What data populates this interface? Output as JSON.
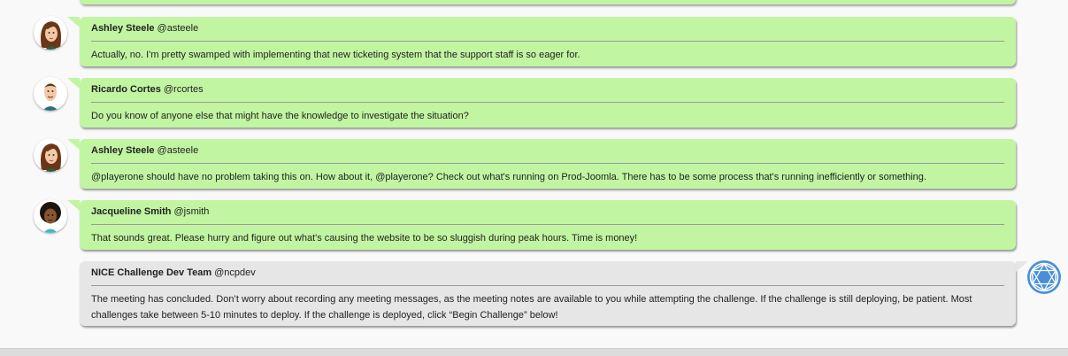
{
  "messages": [
    {
      "name": "Ashley Steele",
      "handle": "@asteele",
      "text": "Actually, no. I'm pretty swamped with implementing that new ticketing system that the support staff is so eager for.",
      "avatar": "ashley-avatar"
    },
    {
      "name": "Ricardo Cortes",
      "handle": "@rcortes",
      "text": "Do you know of anyone else that might have the knowledge to investigate the situation?",
      "avatar": "ricardo-avatar"
    },
    {
      "name": "Ashley Steele",
      "handle": "@asteele",
      "text": "@playerone should have no problem taking this on. How about it, @playerone? Check out what's running on Prod-Joomla. There has to be some process that's running inefficiently or something.",
      "avatar": "ashley-avatar"
    },
    {
      "name": "Jacqueline Smith",
      "handle": "@jsmith",
      "text": "That sounds great. Please hurry and figure out what's causing the website to be so sluggish during peak hours. Time is money!",
      "avatar": "jacqueline-avatar"
    },
    {
      "name": "NICE Challenge Dev Team",
      "handle": "@ncpdev",
      "text": "The meeting has concluded. Don’t worry about recording any meeting messages, as the meeting notes are available to you while attempting the challenge. If the challenge is still deploying, be patient. Most challenges take between 5-10 minutes to deploy. If the challenge is deployed, click “Begin Challenge” below!",
      "avatar": "nice-logo-icon"
    }
  ],
  "colors": {
    "user_bubble": "#c2f5a2",
    "system_bubble": "#e6e6e6",
    "logo": "#4a8fd6"
  }
}
